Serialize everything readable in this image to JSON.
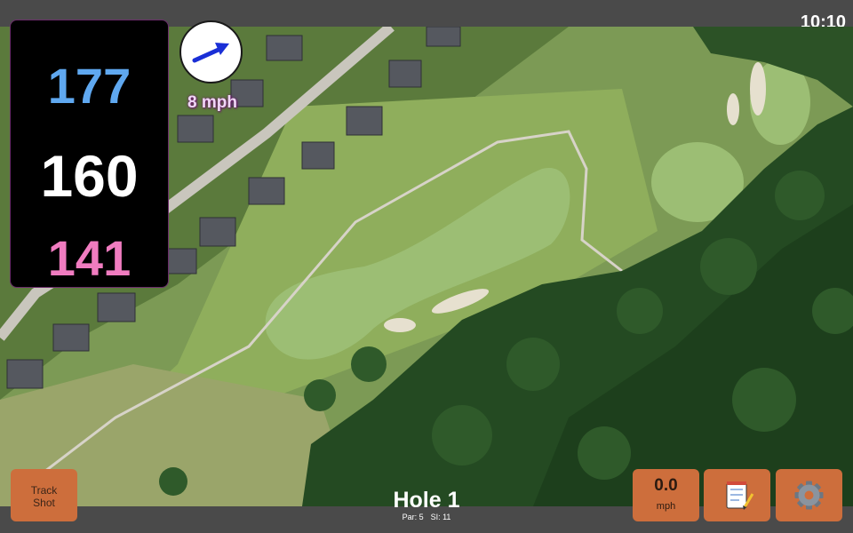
{
  "status": {
    "time": "10:10"
  },
  "distances": {
    "back": "177",
    "middle": "160",
    "front": "141"
  },
  "wind": {
    "label": "8 mph",
    "speed_value": "0.0",
    "speed_unit": "mph",
    "icon": "wind-arrow-icon"
  },
  "hole": {
    "title": "Hole 1",
    "par_label": "Par: 5",
    "si_label": "SI: 11"
  },
  "buttons": {
    "track_shot": "Track Shot",
    "notes_icon": "notepad-icon",
    "settings_icon": "gear-icon"
  },
  "colors": {
    "back_distance": "#5fa8f0",
    "middle_distance": "#ffffff",
    "front_distance": "#f07cc0",
    "button": "#cd6e3c",
    "bar": "#4a4a4a",
    "panel": "#000000"
  }
}
